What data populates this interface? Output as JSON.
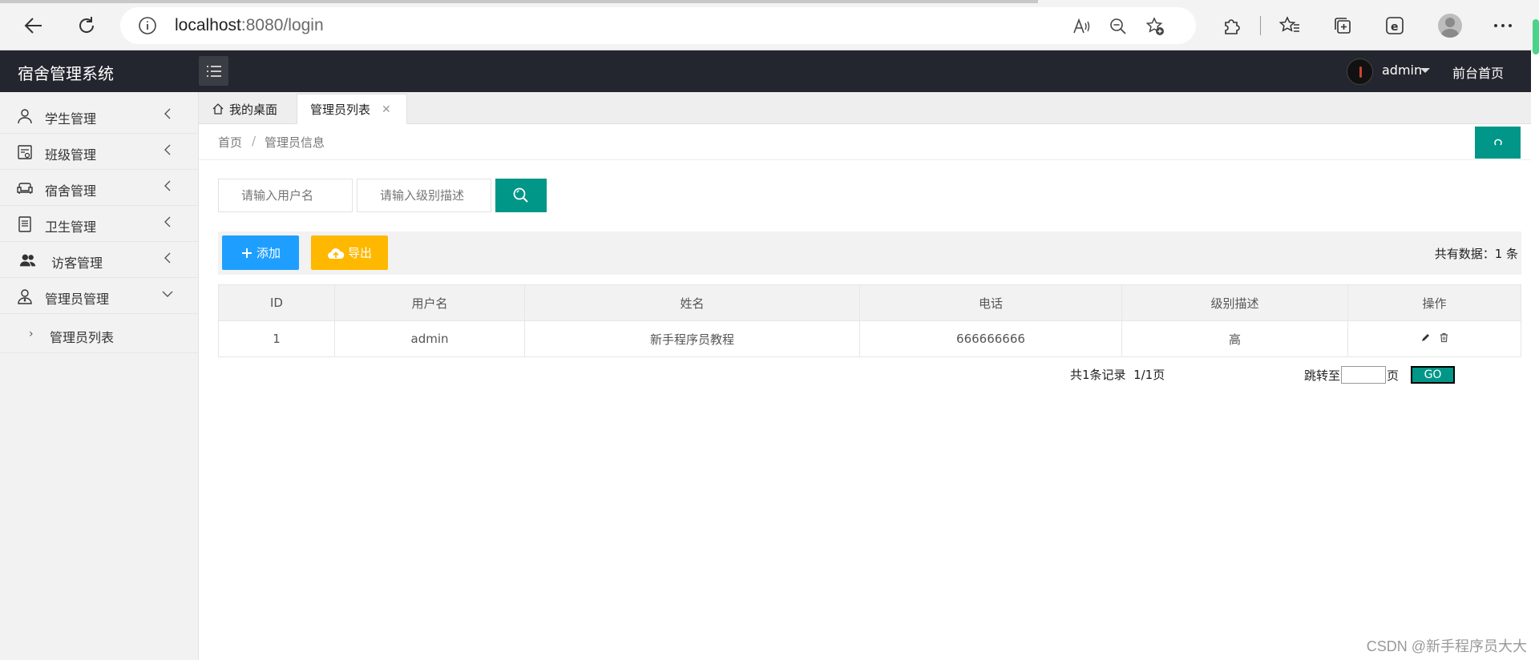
{
  "browser": {
    "url_host": "localhost",
    "url_rest": ":8080/login"
  },
  "header": {
    "app_title": "宿舍管理系统",
    "user_name": "admin",
    "front_link": "前台首页"
  },
  "sidebar": {
    "items": [
      {
        "label": "学生管理",
        "icon": "user-icon"
      },
      {
        "label": "班级管理",
        "icon": "class-icon"
      },
      {
        "label": "宿舍管理",
        "icon": "sofa-icon"
      },
      {
        "label": "卫生管理",
        "icon": "document-icon"
      },
      {
        "label": "访客管理",
        "icon": "users-icon"
      },
      {
        "label": "管理员管理",
        "icon": "admin-icon"
      }
    ],
    "sub_items": [
      {
        "label": "管理员列表"
      }
    ]
  },
  "tabs": [
    {
      "label": "我的桌面"
    },
    {
      "label": "管理员列表"
    }
  ],
  "breadcrumb": {
    "home": "首页",
    "separator": "/",
    "current": "管理员信息"
  },
  "search": {
    "username_placeholder": "请输入用户名",
    "level_placeholder": "请输入级别描述"
  },
  "toolbar": {
    "add_label": "添加",
    "export_label": "导出",
    "total_label": "共有数据：1 条"
  },
  "table": {
    "columns": [
      "ID",
      "用户名",
      "姓名",
      "电话",
      "级别描述",
      "操作"
    ],
    "rows": [
      {
        "id": "1",
        "username": "admin",
        "name": "新手程序员教程",
        "phone": "666666666",
        "level": "高"
      }
    ]
  },
  "pager": {
    "info": "共1条记录  1/1页",
    "jump_prefix": "跳转至",
    "jump_suffix": "页",
    "go_label": "GO"
  },
  "watermark": "CSDN @新手程序员大大",
  "colors": {
    "primary": "#009688",
    "blue": "#1e9fff",
    "orange": "#ffb800",
    "header_bg": "#23262e"
  }
}
